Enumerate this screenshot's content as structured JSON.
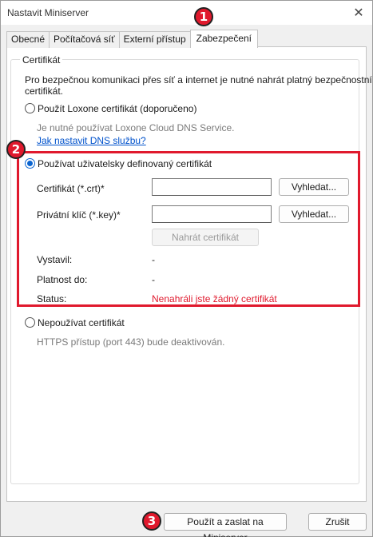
{
  "window": {
    "title": "Nastavit Miniserver"
  },
  "tabs": [
    "Obecné",
    "Počítačová síť",
    "Externí přístup",
    "Zabezpečení"
  ],
  "certificate_group": {
    "legend": "Certifikát",
    "intro_line1": "Pro bezpečnou komunikaci přes síť a internet je nutné nahrát platný bezpečnostní",
    "intro_line2": "certifikát.",
    "loxone_option": "Použít Loxone certifikát (doporučeno)",
    "loxone_note": "Je nutné používat Loxone Cloud DNS Service.",
    "dns_link": "Jak nastavit DNS službu?",
    "custom_option": "Používat uživatelsky definovaný certifikát",
    "cert_label": "Certifikát (*.crt)*",
    "cert_value": "",
    "key_label": "Privátní klíč (*.key)*",
    "key_value": "",
    "browse_label": "Vyhledat...",
    "upload_label": "Nahrát certifikát",
    "issuer_label": "Vystavil:",
    "issuer_value": "-",
    "validity_label": "Platnost do:",
    "validity_value": "-",
    "status_label": "Status:",
    "status_value": "Nenahráli jste žádný certifikát",
    "none_option": "Nepoužívat certifikát",
    "none_note": "HTTPS přístup (port 443) bude deaktivován."
  },
  "footer": {
    "apply_label": "Použít a zaslat na Miniserver",
    "cancel_label": "Zrušit"
  },
  "annotations": {
    "one": "1",
    "two": "2",
    "three": "3"
  },
  "colors": {
    "accent": "#0a64d0",
    "annotation": "#e0192d",
    "link": "#0052cc"
  },
  "selected_option": "custom"
}
